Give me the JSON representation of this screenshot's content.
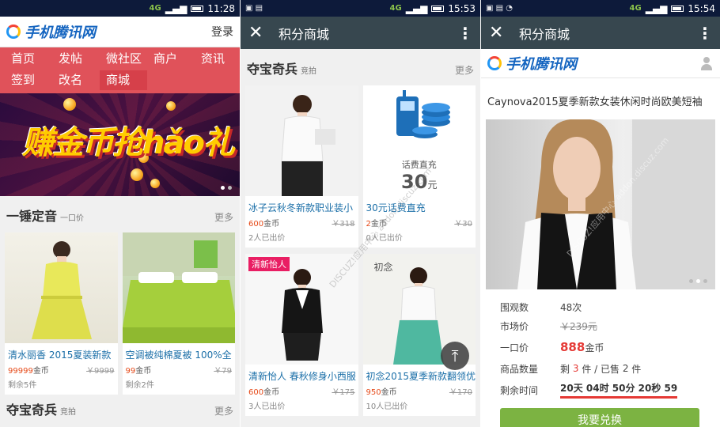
{
  "panel1": {
    "status": {
      "network": "4G",
      "network2": "4G 3G",
      "time": "11:28"
    },
    "logo_text": "手机腾讯网",
    "login": "登录",
    "nav": [
      {
        "label": "首页"
      },
      {
        "label": "发帖"
      },
      {
        "label": "微社区"
      },
      {
        "label": "商户"
      },
      {
        "label": "资讯"
      },
      {
        "label": "签到"
      },
      {
        "label": "改名"
      },
      {
        "label": "商城",
        "active": true
      }
    ],
    "banner_text": "赚金币抢hǎo礼",
    "section1": {
      "title": "一锤定音",
      "subtitle": "一口价",
      "more": "更多"
    },
    "products": [
      {
        "name": "清水丽香 2015夏装新款",
        "price": "99999",
        "unit": "金币",
        "market": "￥9999",
        "left": "剩余5件"
      },
      {
        "name": "空调被纯棉夏被 100%全",
        "price": "99",
        "unit": "金币",
        "market": "￥79",
        "left": "剩余2件"
      }
    ],
    "section2": {
      "title": "夺宝奇兵",
      "subtitle": "竞拍",
      "more": "更多"
    }
  },
  "panel2": {
    "status": {
      "network": "4G",
      "network2": "4G 3G",
      "time": "15:53"
    },
    "title": "积分商城",
    "section": {
      "title": "夺宝奇兵",
      "subtitle": "竞拍",
      "more": "更多"
    },
    "products": [
      {
        "name": "冰子云秋冬新款职业装小",
        "price": "600",
        "unit": "金币",
        "market": "￥318",
        "bids": "2人已出价"
      },
      {
        "name": "30元话费直充",
        "price": "2",
        "unit": "金币",
        "market": "￥30",
        "bids": "0人已出价",
        "card_label": "话费直充",
        "card_amount": "30",
        "card_unit": "元"
      },
      {
        "name": "清新怡人 春秋修身小西服",
        "price": "600",
        "unit": "金币",
        "market": "￥175",
        "bids": "3人已出价",
        "tag": "清新怡人"
      },
      {
        "name": "初念2015夏季新款翻领优",
        "price": "950",
        "unit": "金币",
        "market": "￥170",
        "bids": "10人已出价",
        "tag": "初念"
      }
    ],
    "to_top": "⤒"
  },
  "panel3": {
    "status": {
      "network": "4G",
      "network2": "4G 3G",
      "time": "15:54"
    },
    "title": "积分商城",
    "logo_text": "手机腾讯网",
    "product_title": "Caynova2015夏季新款女装休闲时尚欧美短袖",
    "rows": {
      "views_label": "围观数",
      "views": "48次",
      "market_label": "市场价",
      "market": "￥239元",
      "price_label": "一口价",
      "price": "888",
      "price_unit": "金币",
      "qty_label": "商品数量",
      "qty_prefix": "剩",
      "qty_left": "3",
      "qty_mid": "件 / 已售",
      "qty_sold": "2",
      "qty_unit": "件",
      "time_label": "剩余时间",
      "time_value": "20天 04时 50分 20秒 59"
    },
    "button": "我要兑换"
  },
  "watermark": "DISCUZ!应用中心 addon.discuz.com"
}
